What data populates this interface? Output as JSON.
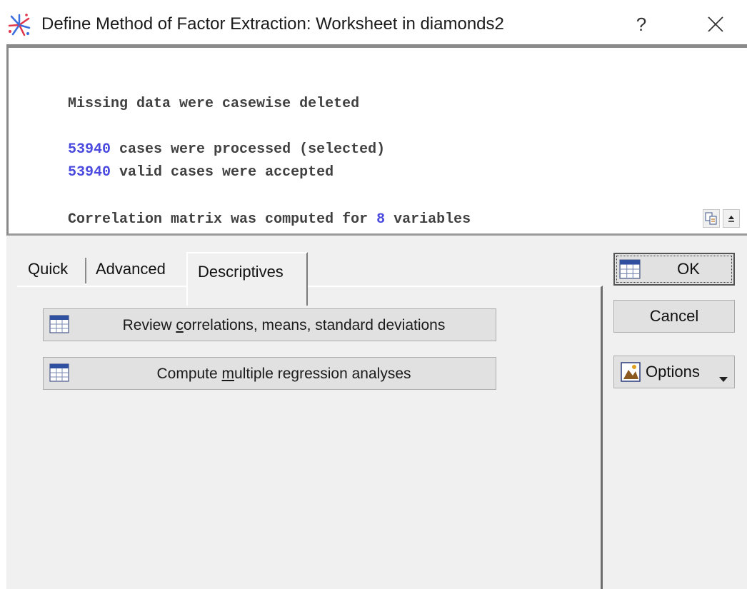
{
  "window": {
    "title": "Define Method of Factor Extraction: Worksheet in diamonds2",
    "help_label": "?"
  },
  "log": {
    "line1": "Missing data were casewise deleted",
    "line2_num": "53940",
    "line2_text": " cases were processed (selected)",
    "line3_num": "53940",
    "line3_text": " valid cases were accepted",
    "line4_text": "Correlation matrix was computed for ",
    "line4_num": "8",
    "line4_end": " variables"
  },
  "tabs": [
    {
      "label": "Quick"
    },
    {
      "label": "Advanced"
    },
    {
      "label": "Descriptives"
    }
  ],
  "descriptives": {
    "review_prefix": "Review ",
    "review_mnemonic": "c",
    "review_suffix": "orrelations, means, standard deviations",
    "regress_prefix": "Compute ",
    "regress_mnemonic": "m",
    "regress_suffix": "ultiple regression analyses"
  },
  "buttons": {
    "ok_label": "OK",
    "cancel_label": "Cancel",
    "options_label": "Options"
  },
  "colors": {
    "number_accent": "#4a4adf",
    "app_icon_red": "#e0344a",
    "app_icon_blue": "#3a6ee0"
  }
}
